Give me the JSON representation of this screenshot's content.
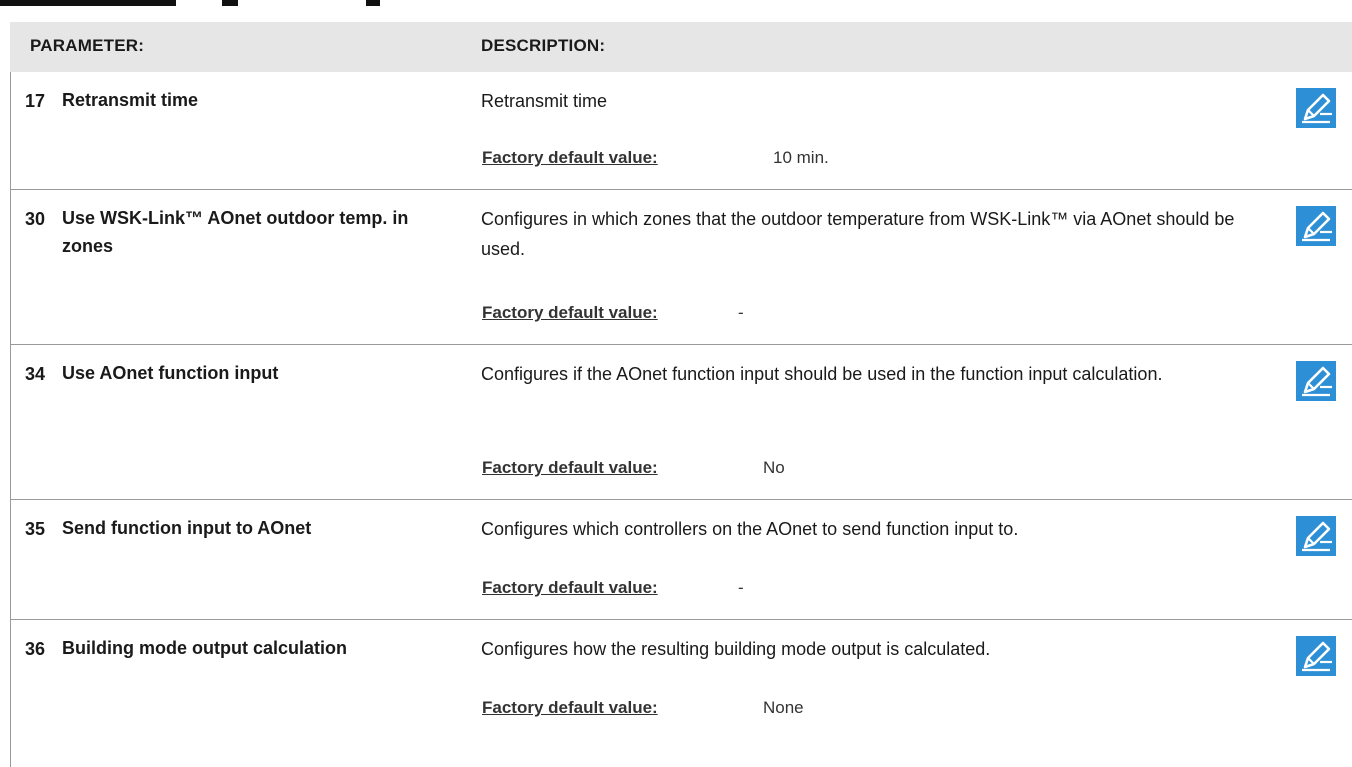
{
  "header": {
    "parameter_label": "PARAMETER:",
    "description_label": "DESCRIPTION:"
  },
  "rows": [
    {
      "number": "17",
      "name": "Retransmit time",
      "description": "Retransmit time",
      "default_label": "Factory default value:",
      "default_value": "10 min."
    },
    {
      "number": "30",
      "name": "Use WSK-Link™ AOnet outdoor temp. in zones",
      "description": "Configures in which zones that the outdoor temperature from WSK-Link™ via AOnet should be used.",
      "default_label": "Factory default value:",
      "default_value": "-"
    },
    {
      "number": "34",
      "name": "Use AOnet function input",
      "description": "Configures if the AOnet function input should be used in the function input calculation.",
      "default_label": "Factory default value:",
      "default_value": "No"
    },
    {
      "number": "35",
      "name": "Send function input to AOnet",
      "description": "Configures which controllers on the AOnet to send function input to.",
      "default_label": "Factory default value:",
      "default_value": "-"
    },
    {
      "number": "36",
      "name": "Building mode output calculation",
      "description": "Configures how the resulting building mode output is calculated.",
      "default_label": "Factory default value:",
      "default_value": "None"
    }
  ],
  "icons": {
    "edit": "edit-pencil-icon"
  },
  "colors": {
    "header_bg": "#e6e6e6",
    "icon_blue": "#2d8fd5",
    "divider": "#9a9a9a"
  }
}
